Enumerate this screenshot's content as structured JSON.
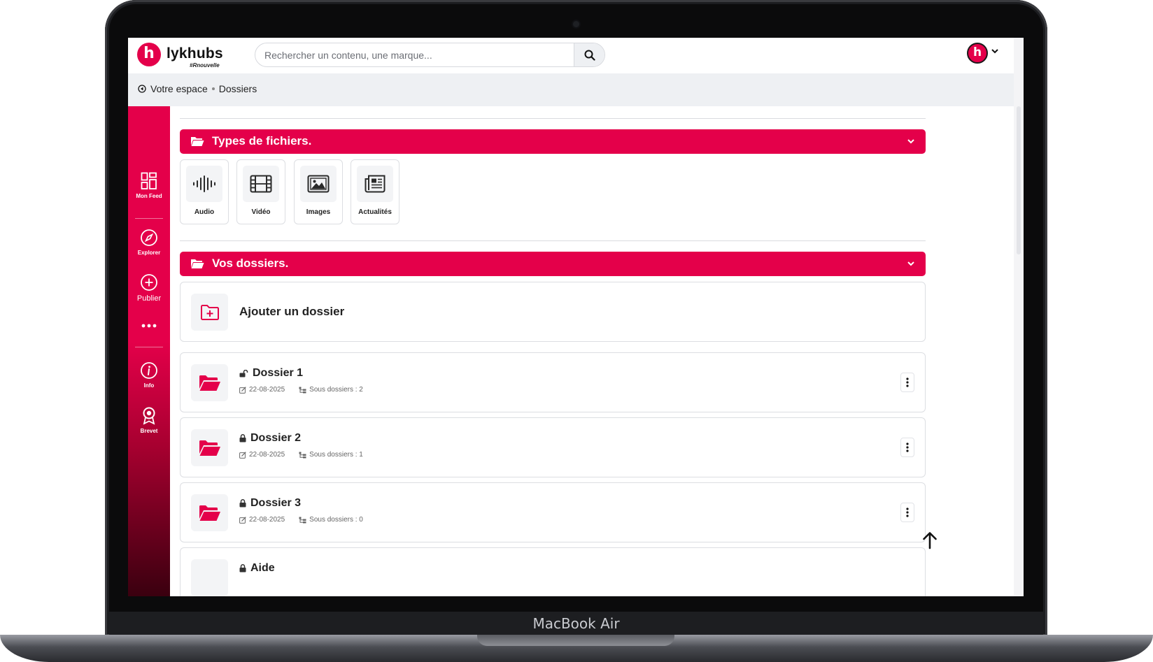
{
  "device": {
    "label": "MacBook Air"
  },
  "header": {
    "logo_letter": "h",
    "brand": "lykhubs",
    "tagline": "#Rnouvelle",
    "search_placeholder": "Rechercher un contenu, une marque...",
    "avatar_letter": "h"
  },
  "breadcrumb": {
    "root": "Votre espace",
    "current": "Dossiers"
  },
  "sidebar": {
    "items": [
      {
        "label": "Mon Feed",
        "icon": "dashboard-icon"
      },
      {
        "label": "Explorer",
        "icon": "compass-icon"
      },
      {
        "label": "Publier",
        "icon": "plus-circle-icon"
      },
      {
        "label": "Info",
        "icon": "info-icon"
      },
      {
        "label": "Brevet",
        "icon": "award-icon"
      }
    ]
  },
  "file_types": {
    "title": "Types de fichiers.",
    "items": [
      {
        "label": "Audio",
        "icon": "audio-wave-icon"
      },
      {
        "label": "Vidéo",
        "icon": "film-icon"
      },
      {
        "label": "Images",
        "icon": "image-icon"
      },
      {
        "label": "Actualités",
        "icon": "newspaper-icon"
      }
    ]
  },
  "folders": {
    "title": "Vos dossiers.",
    "add_label": "Ajouter un dossier",
    "items": [
      {
        "name": "Dossier 1",
        "date": "22-08-2025",
        "subfolders": "Sous dossiers : 2",
        "lock": "unlocked"
      },
      {
        "name": "Dossier 2",
        "date": "22-08-2025",
        "subfolders": "Sous dossiers : 1",
        "lock": "locked"
      },
      {
        "name": "Dossier 3",
        "date": "22-08-2025",
        "subfolders": "Sous dossiers : 0",
        "lock": "locked"
      },
      {
        "name": "Aide",
        "lock": "locked"
      }
    ]
  },
  "colors": {
    "accent": "#e4004a",
    "sidebar_dark": "#3a000f",
    "breadcrumb_bg": "#eef0f3"
  }
}
